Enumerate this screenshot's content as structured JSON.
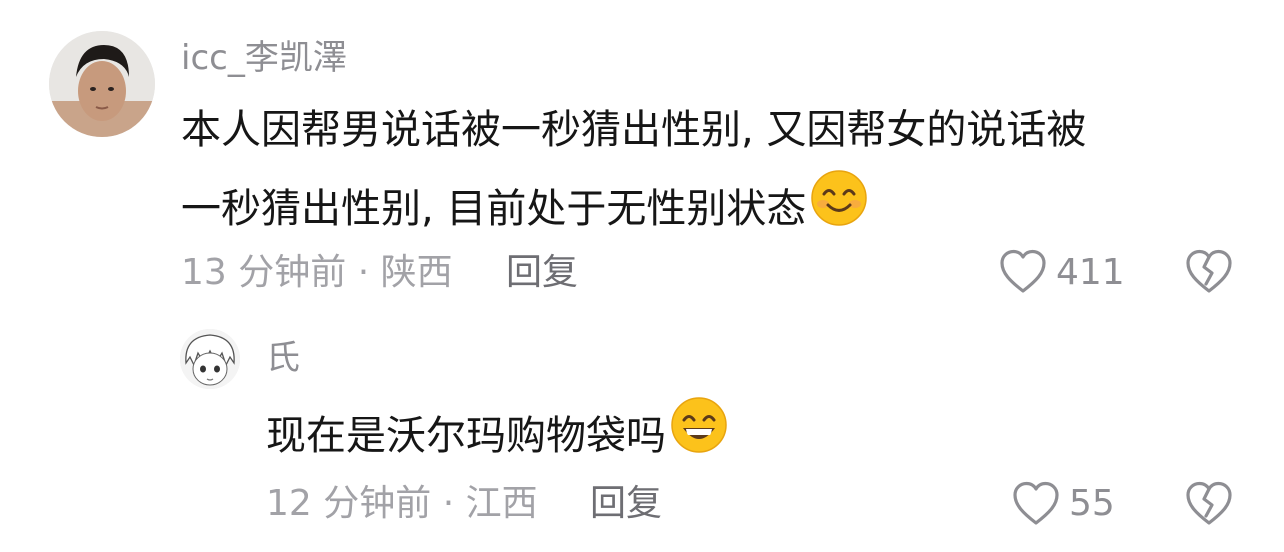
{
  "comment": {
    "username": "icc_李凯澤",
    "text_line1": "本人因帮男说话被一秒猜出性别, 又因帮女的说话被",
    "text_line2": "一秒猜出性别, 目前处于无性别状态",
    "emoji": "smiling-face-emoji",
    "meta": "13 分钟前 · 陕西",
    "reply_label": "回复",
    "like_count": "411",
    "icons": {
      "like": "heart-outline-icon",
      "dislike": "broken-heart-icon"
    }
  },
  "reply": {
    "username": "氏",
    "text": "现在是沃尔玛购物袋吗",
    "emoji": "grinning-face-emoji",
    "meta": "12 分钟前 · 江西",
    "reply_label": "回复",
    "like_count": "55",
    "icons": {
      "like": "heart-outline-icon",
      "dislike": "broken-heart-icon"
    }
  },
  "colors": {
    "username": "#8e8e93",
    "text": "#161616",
    "meta": "#a2a2a7",
    "reply_button": "#6e6e73",
    "icon": "#8e8e93",
    "emoji_face": "#fcc21b"
  }
}
